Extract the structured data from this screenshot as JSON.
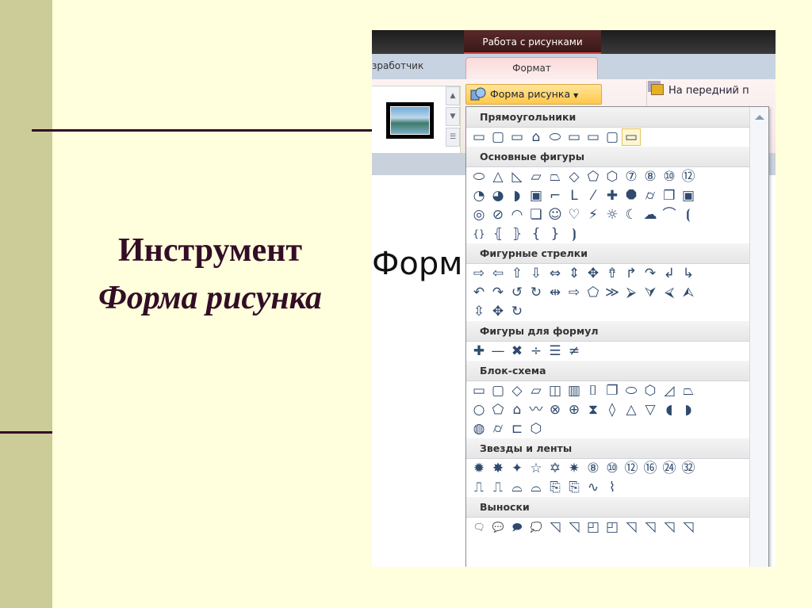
{
  "slide": {
    "title_line1": "Инструмент",
    "title_line2": "Форма рисунка"
  },
  "ribbon": {
    "context_tab": "Работа с рисунками",
    "tab_developer": "зработчик",
    "tab_format": "Формат",
    "shape_button": "Форма рисунка",
    "front_button": "На передний п",
    "doc_text": "Форм"
  },
  "gallery": {
    "sections": [
      {
        "label": "Прямоугольники",
        "rows": [
          [
            "▭",
            "▢",
            "▭",
            "⌂",
            "⬭",
            "▭",
            "▭",
            "▢",
            "▭"
          ]
        ],
        "selected": 8
      },
      {
        "label": "Основные фигуры",
        "rows": [
          [
            "⬭",
            "△",
            "◺",
            "▱",
            "⏢",
            "◇",
            "⬠",
            "⬡",
            "⑦",
            "⑧",
            "⑩",
            "⑫"
          ],
          [
            "◔",
            "◕",
            "◗",
            "▣",
            "⌐",
            "L",
            "⁄",
            "✚",
            "⯃",
            "⌭",
            "❒",
            "▣"
          ],
          [
            "◎",
            "⊘",
            "◠",
            "❏",
            "☺",
            "♡",
            "⚡",
            "☼",
            "☾",
            "☁",
            "⌒",
            "⦗"
          ],
          [
            "{}",
            "⦃",
            "⦄",
            "{",
            "}",
            "⦘"
          ]
        ]
      },
      {
        "label": "Фигурные стрелки",
        "rows": [
          [
            "⇨",
            "⇦",
            "⇧",
            "⇩",
            "⇔",
            "⇕",
            "✥",
            "⇮",
            "↱",
            "↷",
            "↲",
            "↳"
          ],
          [
            "↶",
            "↷",
            "↺",
            "↻",
            "⇹",
            "⇨",
            "⬠",
            "≫",
            "⮚",
            "⮛",
            "⮘",
            "⮙"
          ],
          [
            "⇳",
            "✥",
            "↻"
          ]
        ]
      },
      {
        "label": "Фигуры для формул",
        "rows": [
          [
            "✚",
            "—",
            "✖",
            "÷",
            "☰",
            "≠"
          ]
        ]
      },
      {
        "label": "Блок-схема",
        "rows": [
          [
            "▭",
            "▢",
            "◇",
            "▱",
            "◫",
            "▥",
            "⌷",
            "❐",
            "⬭",
            "⬡",
            "◿",
            "⏢"
          ],
          [
            "○",
            "⬠",
            "⌂",
            "〰",
            "⊗",
            "⊕",
            "⧗",
            "◊",
            "△",
            "▽",
            "◖",
            "◗"
          ],
          [
            "◍",
            "⌭",
            "⊏",
            "⬡"
          ]
        ]
      },
      {
        "label": "Звезды и ленты",
        "rows": [
          [
            "✹",
            "✸",
            "✦",
            "☆",
            "✡",
            "✷",
            "⑧",
            "⑩",
            "⑫",
            "⑯",
            "㉔",
            "㉜"
          ],
          [
            "⎍",
            "⎍",
            "⌓",
            "⌓",
            "⎘",
            "⎘",
            "∿",
            "⌇"
          ]
        ]
      },
      {
        "label": "Выноски",
        "rows": [
          [
            "🗨",
            "💬",
            "🗩",
            "💭",
            "◹",
            "◹",
            "◰",
            "◰",
            "◹",
            "◹",
            "◹",
            "◹"
          ]
        ]
      }
    ]
  }
}
